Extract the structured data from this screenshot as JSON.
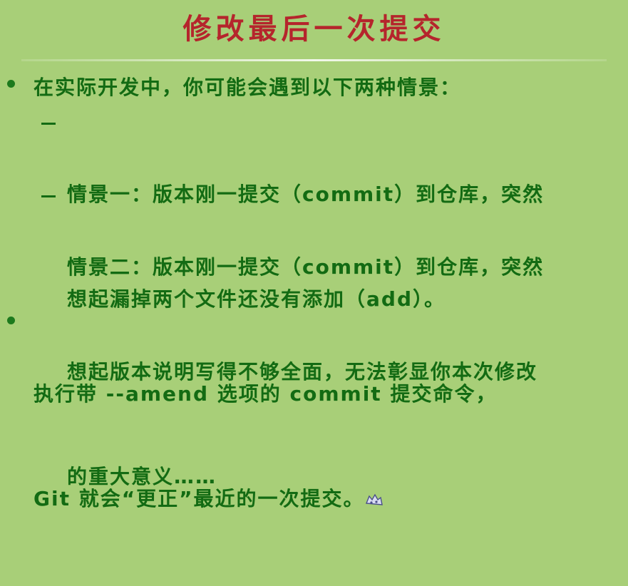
{
  "slide": {
    "title": "修改最后一次提交",
    "bullet1": "在实际开发中，你可能会遇到以下两种情景：",
    "scenario1": {
      "line1": "情景一：版本刚一提交（commit）到仓库，突然",
      "line2": "想起漏掉两个文件还没有添加（add）。"
    },
    "scenario2": {
      "line1": "情景二：版本刚一提交（commit）到仓库，突然",
      "line2": "想起版本说明写得不够全面，无法彰显你本次修改",
      "line3": "的重大意义……"
    },
    "bullet2": {
      "line1": "执行带 --amend 选项的 commit 提交命令，",
      "line2": "Git 就会“更正”最近的一次提交。"
    },
    "icons": {
      "pointer": "mouse-icon"
    },
    "colors": {
      "background": "#a8cf78",
      "title": "#b5252c",
      "text": "#136b13"
    }
  }
}
